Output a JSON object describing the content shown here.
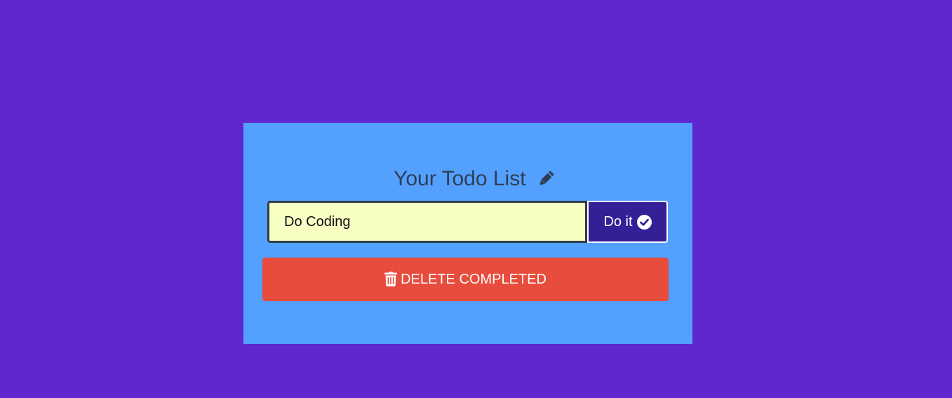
{
  "colors": {
    "page_background": "#5f27cd",
    "card_background": "#54a0ff",
    "input_background": "#f8ffc3",
    "submit_button": "#341f97",
    "delete_button": "#e74c3c",
    "title_text": "#2f3e55"
  },
  "header": {
    "title": "Your Todo List",
    "icon": "pencil-icon"
  },
  "todo_form": {
    "input_value": "Do Coding",
    "submit_label": "Do it",
    "submit_icon": "check-circle-icon"
  },
  "actions": {
    "delete_completed_label": "DELETE COMPLETED",
    "delete_icon": "trash-icon"
  }
}
